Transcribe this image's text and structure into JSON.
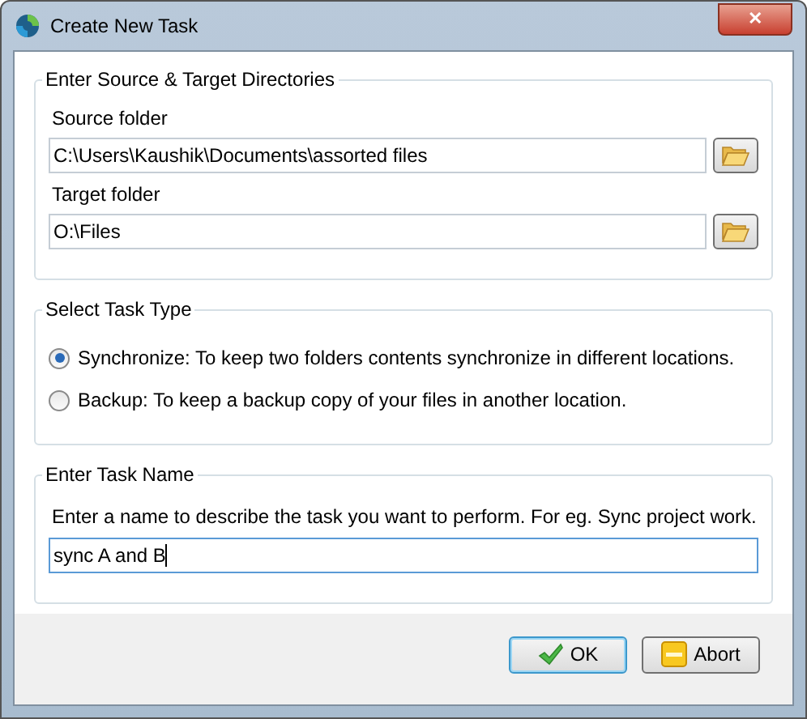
{
  "window": {
    "title": "Create New Task",
    "close": "✕"
  },
  "directories": {
    "title": "Enter Source & Target Directories",
    "fields": [
      {
        "label": "Source folder",
        "value": "C:\\Users\\Kaushik\\Documents\\assorted files"
      },
      {
        "label": "Target folder",
        "value": "O:\\Files"
      }
    ]
  },
  "task_type": {
    "title": "Select Task Type",
    "options": [
      {
        "label": "Synchronize: To keep two folders contents synchronize in different locations.",
        "selected": true
      },
      {
        "label": "Backup: To keep a backup copy of your files in another location.",
        "selected": false
      }
    ]
  },
  "task_name": {
    "title": "Enter Task Name",
    "hint": "Enter a name to describe the task you want to perform. For eg. Sync project work.",
    "value": "sync A and B",
    "focused": true
  },
  "buttons": [
    {
      "label": "OK",
      "kind": "ok",
      "default": true
    },
    {
      "label": "Abort",
      "kind": "abort",
      "default": false
    }
  ]
}
